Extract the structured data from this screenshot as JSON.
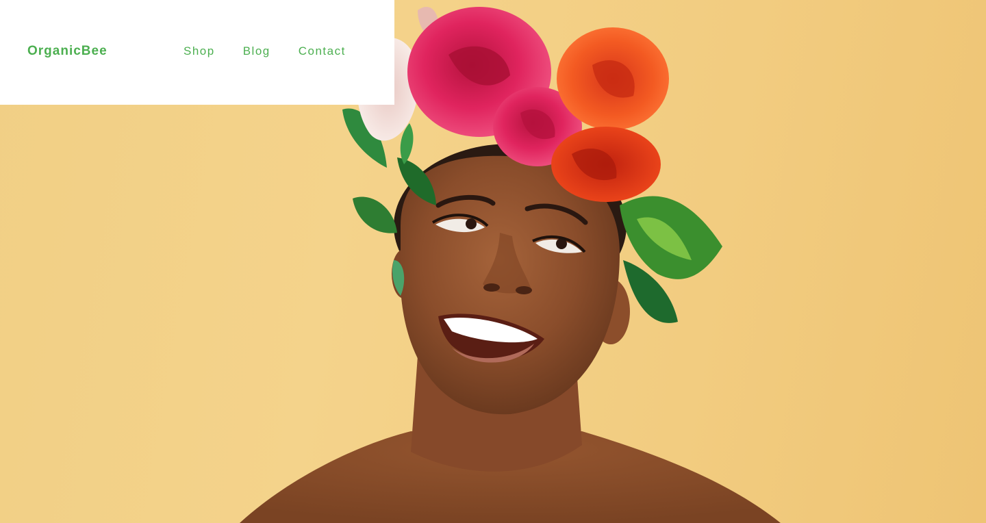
{
  "header": {
    "brand": "OrganicBee",
    "nav": [
      {
        "label": "Shop"
      },
      {
        "label": "Blog"
      },
      {
        "label": "Contact"
      }
    ]
  },
  "colors": {
    "brand_green": "#4caf50",
    "background_yellow": "#f2cd82",
    "header_background": "#ffffff"
  },
  "hero": {
    "image": "woman-with-flower-crown-photo"
  }
}
